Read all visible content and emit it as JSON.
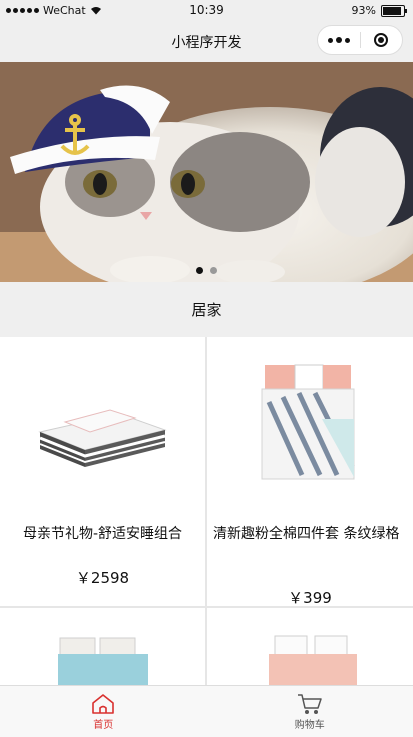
{
  "status_bar": {
    "carrier": "WeChat",
    "time": "10:39",
    "battery": "93%"
  },
  "nav": {
    "title": "小程序开发"
  },
  "banner": {
    "slides": 2,
    "active_slide": 1
  },
  "section": {
    "title": "居家"
  },
  "products": [
    {
      "title": "母亲节礼物-舒适安睡组合",
      "price": "￥2598"
    },
    {
      "title": "清新趣粉全棉四件套 条纹绿格",
      "price": "￥399"
    }
  ],
  "tabs": [
    {
      "label": "首页",
      "active": true,
      "color": "#d9312f"
    },
    {
      "label": "购物车",
      "active": false,
      "color": "#555555"
    }
  ]
}
